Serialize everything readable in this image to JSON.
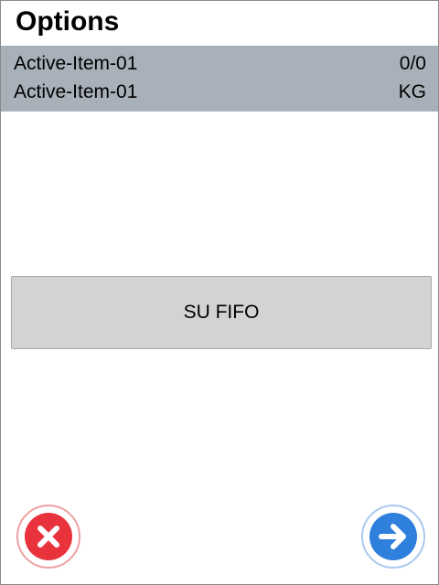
{
  "header": {
    "title": "Options"
  },
  "info": {
    "rows": [
      {
        "label": "Active-Item-01",
        "value": "0/0"
      },
      {
        "label": "Active-Item-01",
        "value": "KG"
      }
    ]
  },
  "actions": {
    "su_fifo_label": "SU FIFO"
  },
  "footer": {
    "cancel_icon": "close-icon",
    "next_icon": "arrow-right-icon",
    "cancel_color": "#e8323c",
    "next_color": "#2f7fdc"
  }
}
